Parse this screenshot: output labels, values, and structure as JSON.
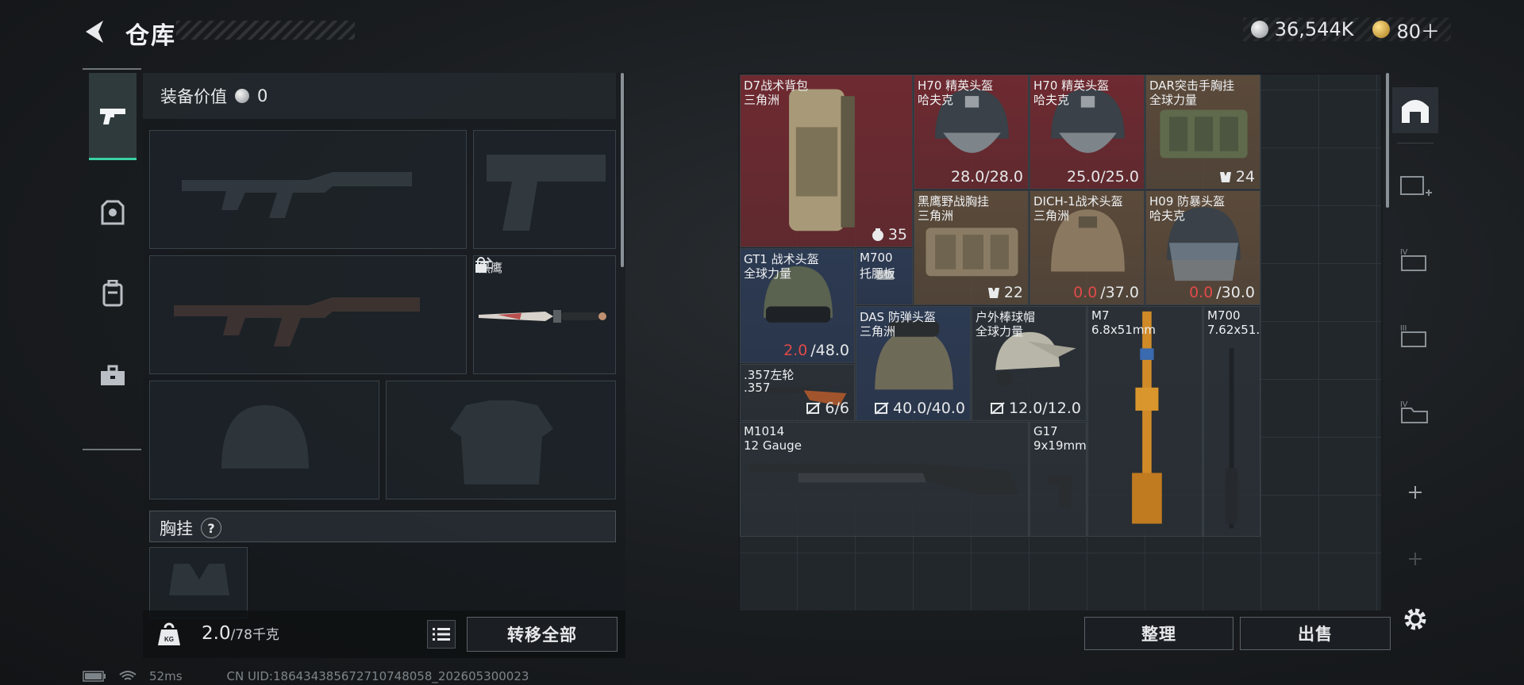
{
  "header": {
    "title": "仓库"
  },
  "currency": {
    "silver": "36,544K",
    "gold": "80＋"
  },
  "left_tabs": [
    {
      "icon": "pistol-icon",
      "active": true
    },
    {
      "icon": "armor-icon",
      "active": false
    },
    {
      "icon": "backpack-icon",
      "active": false
    },
    {
      "icon": "toolbox-icon",
      "active": false
    }
  ],
  "equipment": {
    "value_label": "装备价值",
    "value": "0",
    "melee_name": "黑鹰",
    "rig_label": "胸挂",
    "rig_help": "?"
  },
  "weight": {
    "current": "2.0",
    "max": "/78千克"
  },
  "buttons": {
    "transfer_all": "转移全部",
    "sort": "整理",
    "sell": "出售"
  },
  "status_bar": {
    "ping": "52ms",
    "uid": "CN UID:1864343856727107480​58_202605300023"
  },
  "stash_items": [
    {
      "name": "D7战术背包",
      "sub": "三角洲",
      "stat": "35",
      "stat_icon": "capacity-icon"
    },
    {
      "name": "H70 精英头盔",
      "sub": "哈夫克",
      "stat": "28.0/28.0"
    },
    {
      "name": "H70 精英头盔",
      "sub": "哈夫克",
      "stat": "25.0/25.0"
    },
    {
      "name": "DAR突击手胸挂",
      "sub": "全球力量",
      "stat": "24",
      "stat_icon": "grid-icon"
    },
    {
      "name": "黑鹰野战胸挂",
      "sub": "三角洲",
      "stat": "22",
      "stat_icon": "grid-icon"
    },
    {
      "name": "DICH-1战术头盔",
      "sub": "三角洲",
      "stat_red": "0.0",
      "stat": "/37.0"
    },
    {
      "name": "H09 防暴头盔",
      "sub": "哈夫克",
      "stat_red": "0.0",
      "stat": "/30.0"
    },
    {
      "name": "GT1 战术头盔",
      "sub": "全球力量",
      "stat_red": "2.0",
      "stat": "/48.0"
    },
    {
      "name": "M700",
      "sub": "托腮板"
    },
    {
      "name": "DAS 防弹头盔",
      "sub": "三角洲",
      "stat": "40.0/40.0",
      "stat_icon": "no-repair-icon"
    },
    {
      "name": "户外棒球帽",
      "sub": "全球力量",
      "stat": "12.0/12.0",
      "stat_icon": "no-repair-icon"
    },
    {
      "name": "M7",
      "sub": "6.8x51mm"
    },
    {
      "name": "M700",
      "sub": "7.62x51..."
    },
    {
      "name": ".357左轮",
      "sub": ".357",
      "stat": "6/6",
      "stat_icon": "no-repair-icon"
    },
    {
      "name": "M1014",
      "sub": "12 Gauge"
    },
    {
      "name": "G17",
      "sub": "9x19mm"
    }
  ],
  "colors": {
    "accent": "#3ad1a3",
    "red_item": "#6e2a30",
    "brown_item": "#5b4a3a",
    "blue_item": "#2c3a52",
    "gray_item": "#2a3036"
  }
}
